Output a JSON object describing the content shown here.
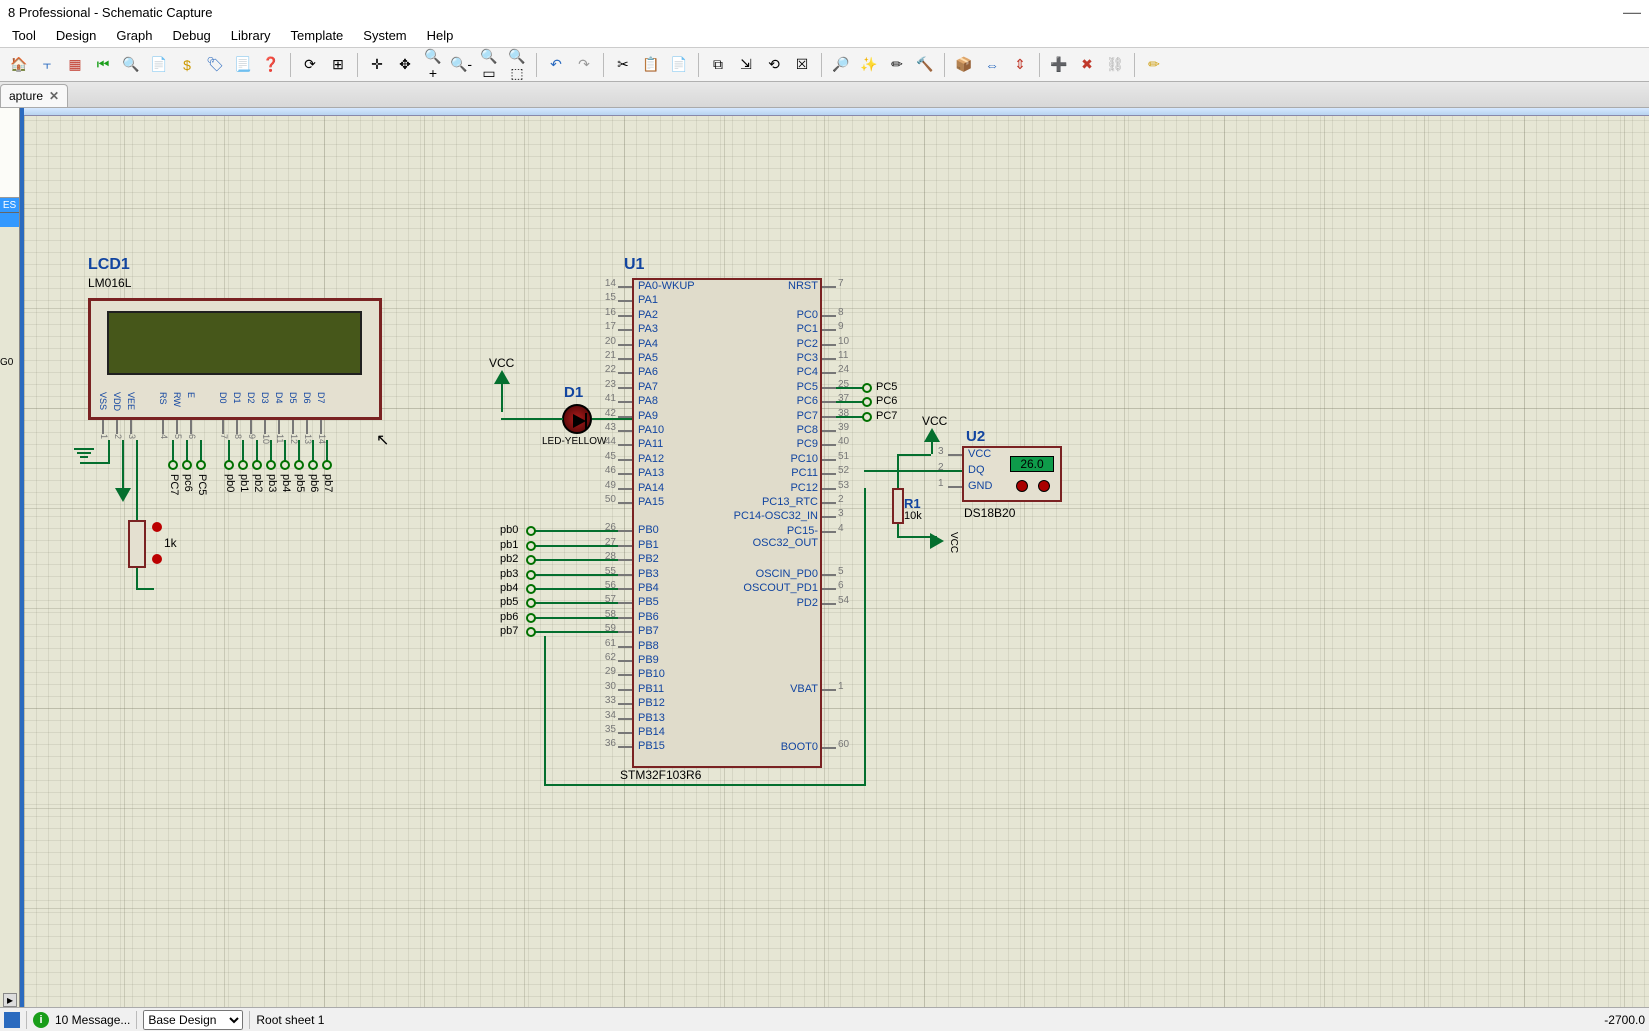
{
  "title": "8 Professional - Schematic Capture",
  "menu": [
    "Tool",
    "Design",
    "Graph",
    "Debug",
    "Library",
    "Template",
    "System",
    "Help"
  ],
  "tab": {
    "label": "apture",
    "close": "✕"
  },
  "leftpanel": {
    "header": "ES",
    "item": "G0"
  },
  "status": {
    "messages": "10 Message...",
    "design": "Base Design",
    "sheet": "Root sheet 1",
    "coord": "-2700.0"
  },
  "lcd": {
    "ref": "LCD1",
    "part": "LM016L",
    "pins": [
      "VSS",
      "VDD",
      "VEE",
      "RS",
      "RW",
      "E",
      "D0",
      "D1",
      "D2",
      "D3",
      "D4",
      "D5",
      "D6",
      "D7"
    ],
    "nums": [
      "1",
      "2",
      "3",
      "4",
      "5",
      "6",
      "7",
      "8",
      "9",
      "10",
      "11",
      "12",
      "13",
      "14"
    ],
    "nets_left": [
      "PC7",
      "pc6",
      "PC5"
    ],
    "nets_right": [
      "pb0",
      "pb1",
      "pb2",
      "pb3",
      "pb4",
      "pb5",
      "pb6",
      "pb7"
    ]
  },
  "pot": {
    "value": "1k"
  },
  "vcc_label": "VCC",
  "led": {
    "ref": "D1",
    "part": "LED-YELLOW"
  },
  "mcu": {
    "ref": "U1",
    "part": "STM32F103R6",
    "left": [
      {
        "n": "14",
        "name": "PA0-WKUP"
      },
      {
        "n": "15",
        "name": "PA1"
      },
      {
        "n": "16",
        "name": "PA2"
      },
      {
        "n": "17",
        "name": "PA3"
      },
      {
        "n": "20",
        "name": "PA4"
      },
      {
        "n": "21",
        "name": "PA5"
      },
      {
        "n": "22",
        "name": "PA6"
      },
      {
        "n": "23",
        "name": "PA7"
      },
      {
        "n": "41",
        "name": "PA8"
      },
      {
        "n": "42",
        "name": "PA9"
      },
      {
        "n": "43",
        "name": "PA10"
      },
      {
        "n": "44",
        "name": "PA11"
      },
      {
        "n": "45",
        "name": "PA12"
      },
      {
        "n": "46",
        "name": "PA13"
      },
      {
        "n": "49",
        "name": "PA14"
      },
      {
        "n": "50",
        "name": "PA15"
      },
      {
        "n": "26",
        "name": "PB0"
      },
      {
        "n": "27",
        "name": "PB1"
      },
      {
        "n": "28",
        "name": "PB2"
      },
      {
        "n": "55",
        "name": "PB3"
      },
      {
        "n": "56",
        "name": "PB4"
      },
      {
        "n": "57",
        "name": "PB5"
      },
      {
        "n": "58",
        "name": "PB6"
      },
      {
        "n": "59",
        "name": "PB7"
      },
      {
        "n": "61",
        "name": "PB8"
      },
      {
        "n": "62",
        "name": "PB9"
      },
      {
        "n": "29",
        "name": "PB10"
      },
      {
        "n": "30",
        "name": "PB11"
      },
      {
        "n": "33",
        "name": "PB12"
      },
      {
        "n": "34",
        "name": "PB13"
      },
      {
        "n": "35",
        "name": "PB14"
      },
      {
        "n": "36",
        "name": "PB15"
      }
    ],
    "right": [
      {
        "n": "7",
        "name": "NRST"
      },
      {
        "n": "8",
        "name": "PC0"
      },
      {
        "n": "9",
        "name": "PC1"
      },
      {
        "n": "10",
        "name": "PC2"
      },
      {
        "n": "11",
        "name": "PC3"
      },
      {
        "n": "24",
        "name": "PC4"
      },
      {
        "n": "25",
        "name": "PC5"
      },
      {
        "n": "37",
        "name": "PC6"
      },
      {
        "n": "38",
        "name": "PC7"
      },
      {
        "n": "39",
        "name": "PC8"
      },
      {
        "n": "40",
        "name": "PC9"
      },
      {
        "n": "51",
        "name": "PC10"
      },
      {
        "n": "52",
        "name": "PC11"
      },
      {
        "n": "53",
        "name": "PC12"
      },
      {
        "n": "2",
        "name": "PC13_RTC"
      },
      {
        "n": "3",
        "name": "PC14-OSC32_IN"
      },
      {
        "n": "4",
        "name": "PC15-OSC32_OUT"
      },
      {
        "n": "5",
        "name": "OSCIN_PD0"
      },
      {
        "n": "6",
        "name": "OSCOUT_PD1"
      },
      {
        "n": "54",
        "name": "PD2"
      },
      {
        "n": "1",
        "name": "VBAT"
      },
      {
        "n": "60",
        "name": "BOOT0"
      }
    ],
    "bus_nets": [
      "pb0",
      "pb1",
      "pb2",
      "pb3",
      "pb4",
      "pb5",
      "pb6",
      "pb7"
    ],
    "right_nets": [
      "PC5",
      "PC6",
      "PC7"
    ]
  },
  "u2": {
    "ref": "U2",
    "part": "DS18B20",
    "pins": [
      {
        "n": "3",
        "name": "VCC"
      },
      {
        "n": "2",
        "name": "DQ"
      },
      {
        "n": "1",
        "name": "GND"
      }
    ],
    "value": "26.0"
  },
  "r1": {
    "ref": "R1",
    "value": "10k"
  },
  "vcc2": "VCC",
  "vcc3": "VCC"
}
